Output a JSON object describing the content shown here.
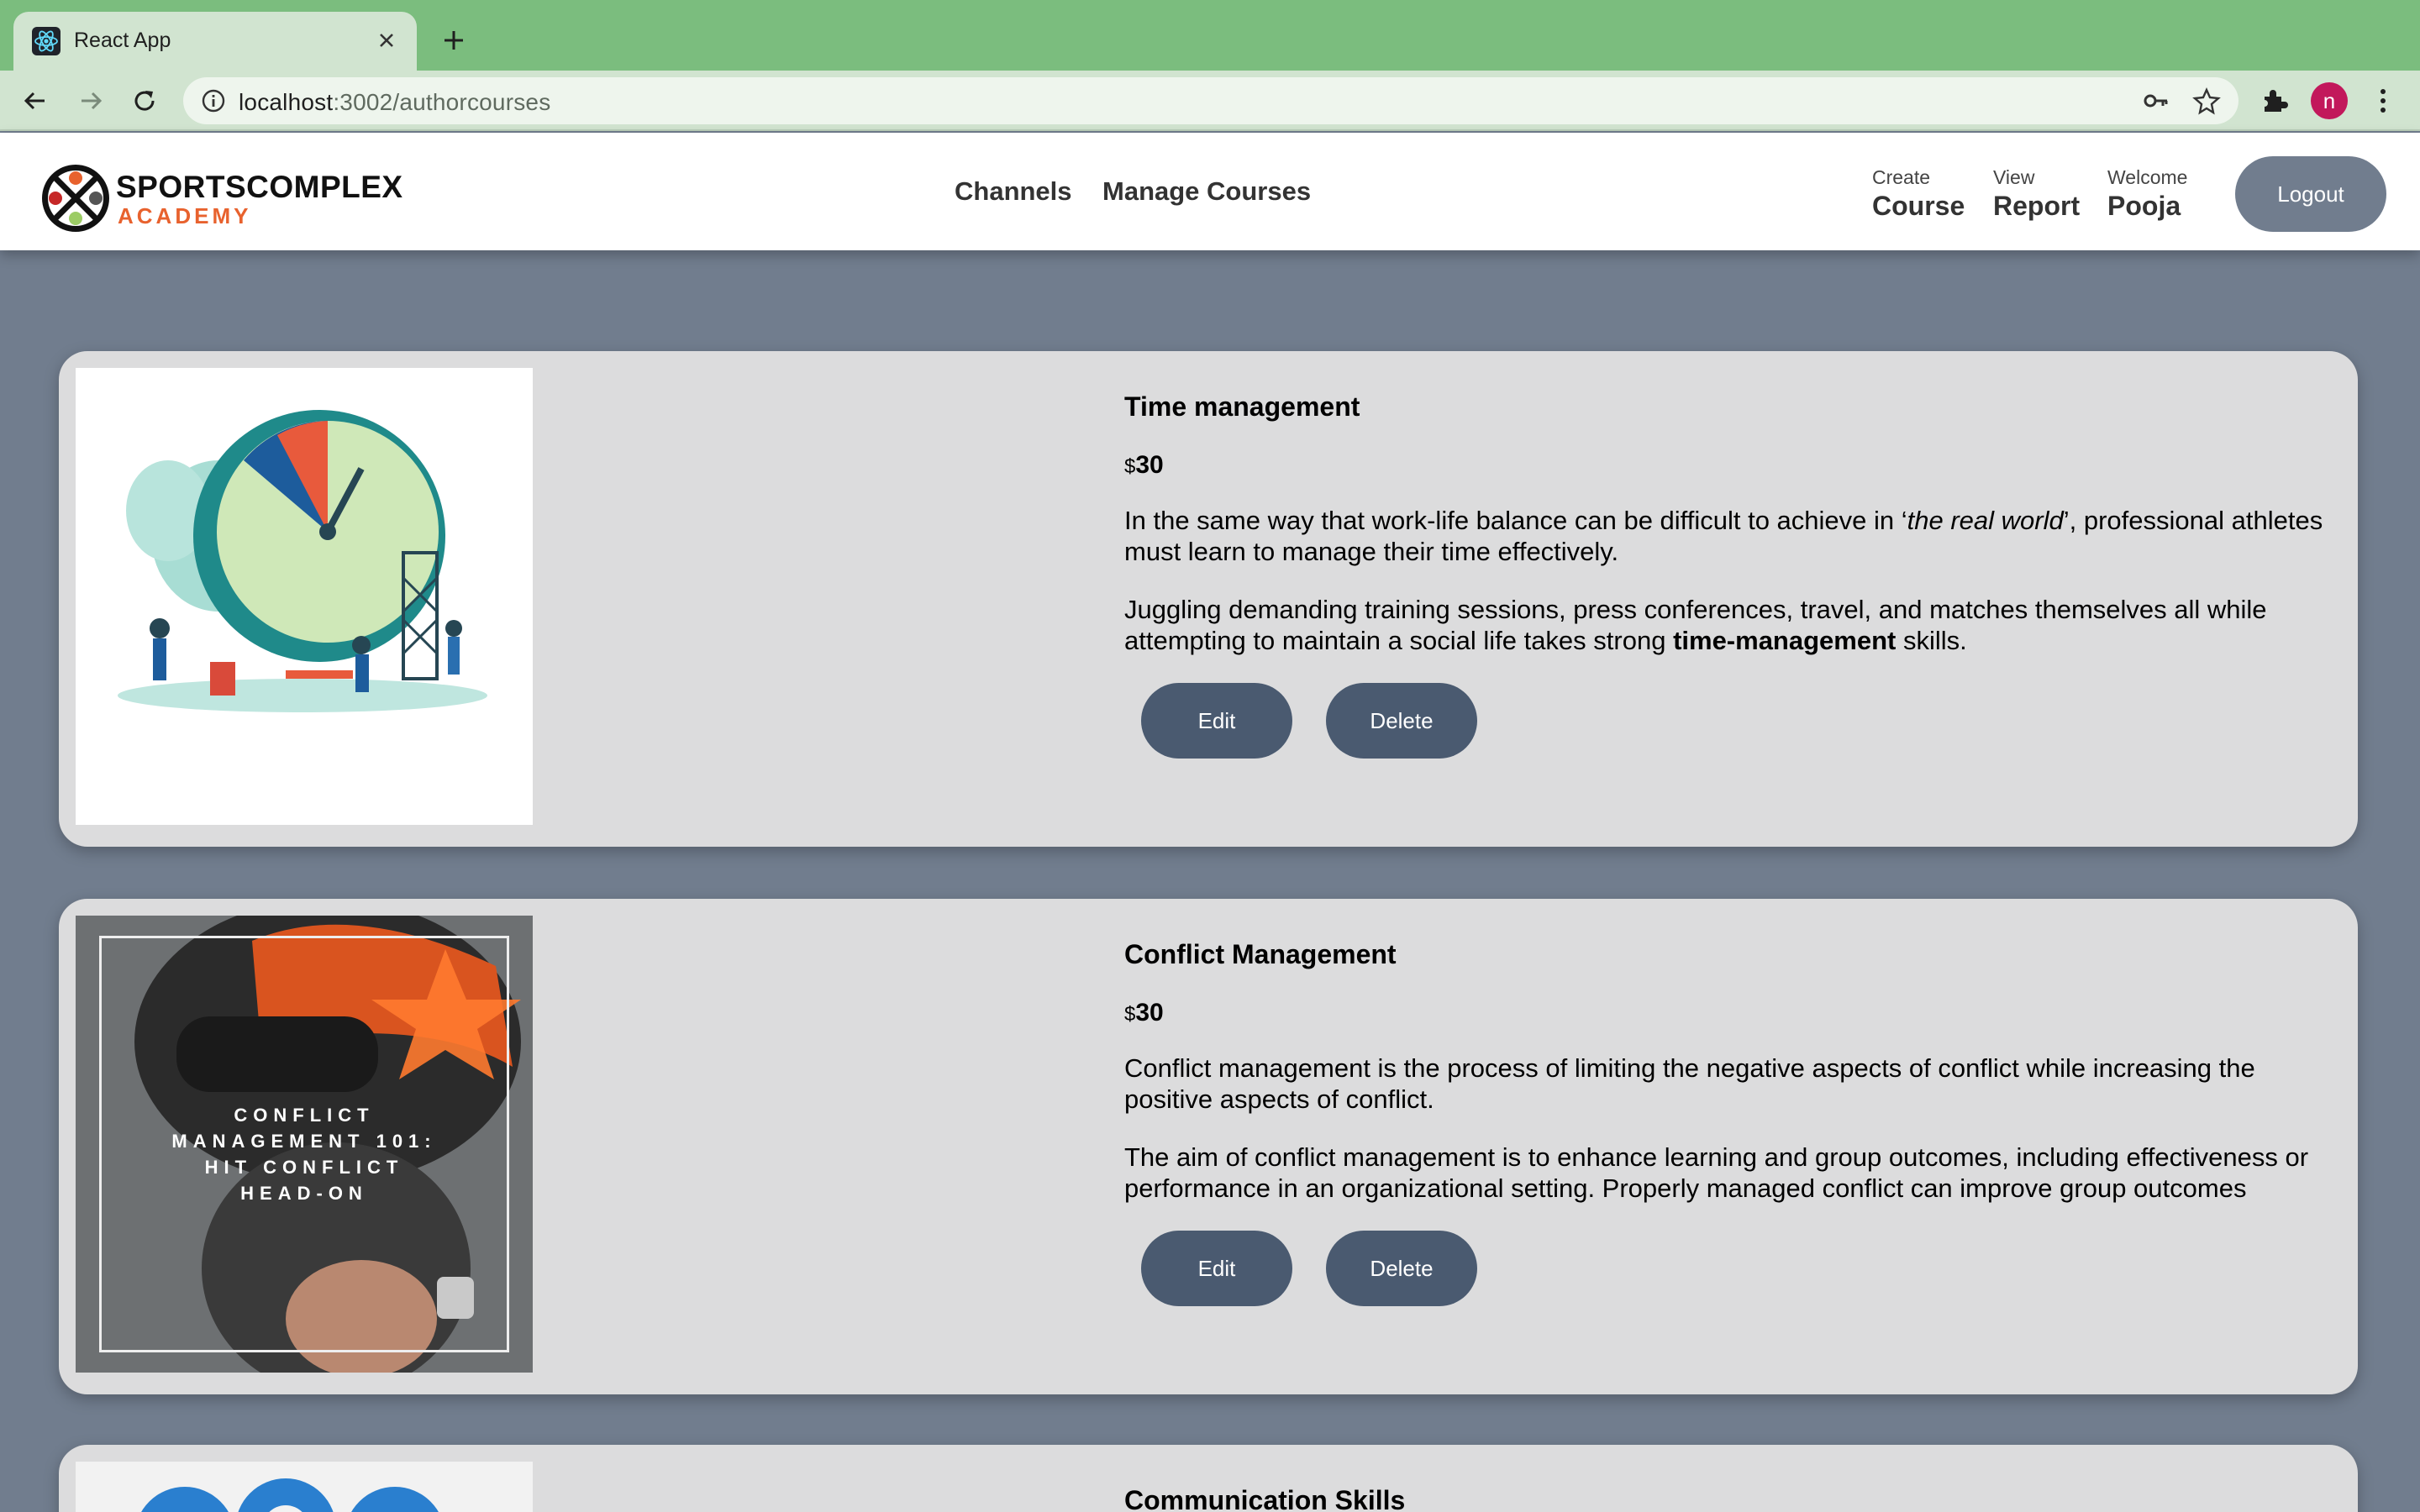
{
  "browser": {
    "tab_title": "React App",
    "url_host": "localhost",
    "url_path": ":3002/authorcourses",
    "profile_initial": "n"
  },
  "header": {
    "logo_line1": "SPORTSCOMPLEX",
    "logo_line2": "ACADEMY",
    "nav": [
      "Channels",
      "Manage Courses"
    ],
    "create_small": "Create",
    "create_big": "Course",
    "view_small": "View",
    "view_big": "Report",
    "welcome_small": "Welcome",
    "welcome_big": "Pooja",
    "logout_label": "Logout"
  },
  "courses": [
    {
      "title": "Time management",
      "currency": "$",
      "price": "30",
      "desc1_a": "In the same way that work-life balance can be difficult to achieve in ‘",
      "desc1_em": "the real world",
      "desc1_b": "’, professional athletes must learn to manage their time effectively.",
      "desc2_a": "Juggling demanding training sessions, press conferences, travel, and matches themselves all while attempting to maintain a social life takes strong ",
      "desc2_strong": "time-management",
      "desc2_b": " skills.",
      "edit_label": "Edit",
      "delete_label": "Delete"
    },
    {
      "title": "Conflict Management",
      "currency": "$",
      "price": "30",
      "image_text": [
        "CONFLICT",
        "MANAGEMENT 101:",
        "HIT CONFLICT",
        "HEAD-ON"
      ],
      "desc1": "Conflict management is the process of limiting the negative aspects of conflict while increasing the positive aspects of conflict.",
      "desc2": "The aim of conflict management is to enhance learning and group outcomes, including effectiveness or performance in an organizational setting. Properly managed conflict can improve group outcomes",
      "edit_label": "Edit",
      "delete_label": "Delete"
    },
    {
      "title": "Communication Skills"
    }
  ],
  "colors": {
    "page_bg": "#717d8e",
    "card_bg": "#dcdcdd",
    "button": "#4a5a70",
    "chrome_tabbar": "#7bbd7e",
    "logo_accent": "#e8622e"
  }
}
